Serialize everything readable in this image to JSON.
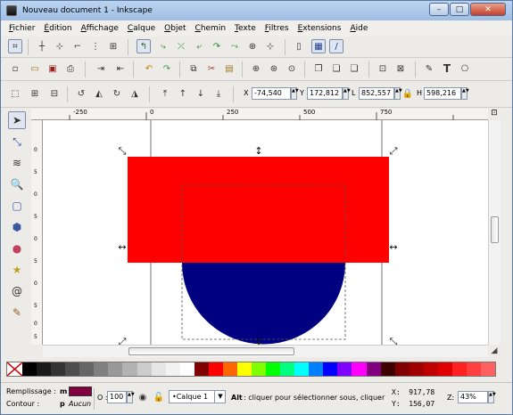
{
  "window": {
    "title": "Nouveau document 1 - Inkscape",
    "minimize": "–",
    "restore": "□",
    "close": "✕"
  },
  "menu": [
    "Fichier",
    "Édition",
    "Affichage",
    "Calque",
    "Objet",
    "Chemin",
    "Texte",
    "Filtres",
    "Extensions",
    "Aide"
  ],
  "coords": {
    "x_label": "X",
    "x_value": "-74,540",
    "y_label": "Y",
    "y_value": "172,812",
    "w_label": "L",
    "w_value": "852,557",
    "h_label": "H",
    "h_value": "598,216"
  },
  "rulers": {
    "h_ticks": [
      "-250",
      "0",
      "250",
      "500",
      "750"
    ],
    "v_ticks": [
      "0",
      "5",
      "0",
      "5",
      "0",
      "5",
      "0",
      "5",
      "0",
      "5"
    ]
  },
  "colors": {
    "rect": "#ff0000",
    "circle": "#000080",
    "fill_swatch": "#800040"
  },
  "palette": [
    "#000000",
    "#1a1a1a",
    "#333333",
    "#4d4d4d",
    "#666666",
    "#808080",
    "#999999",
    "#b3b3b3",
    "#cccccc",
    "#e6e6e6",
    "#f2f2f2",
    "#ffffff",
    "#800000",
    "#ff0000",
    "#ff6600",
    "#ffff00",
    "#80ff00",
    "#00ff00",
    "#00ff80",
    "#00ffff",
    "#0080ff",
    "#0000ff",
    "#8000ff",
    "#ff00ff",
    "#800080",
    "#400000",
    "#800000",
    "#a00000",
    "#c00000",
    "#e00000",
    "#ff2020",
    "#ff4040",
    "#ff6060"
  ],
  "status": {
    "fill_label": "Remplissage :",
    "fill_value": "m",
    "stroke_label": "Contour :",
    "stroke_value": "p",
    "stroke_none": "Aucun",
    "opacity_label": "O :",
    "opacity_value": "100",
    "layer": "•Calque 1",
    "message_bold": "Alt",
    "message": " : cliquer pour sélectionner sous, cliquer",
    "cursor_x": "X:  917,78",
    "cursor_y": "Y:  156,07",
    "zoom_label": "Z:",
    "zoom_value": "43%"
  }
}
